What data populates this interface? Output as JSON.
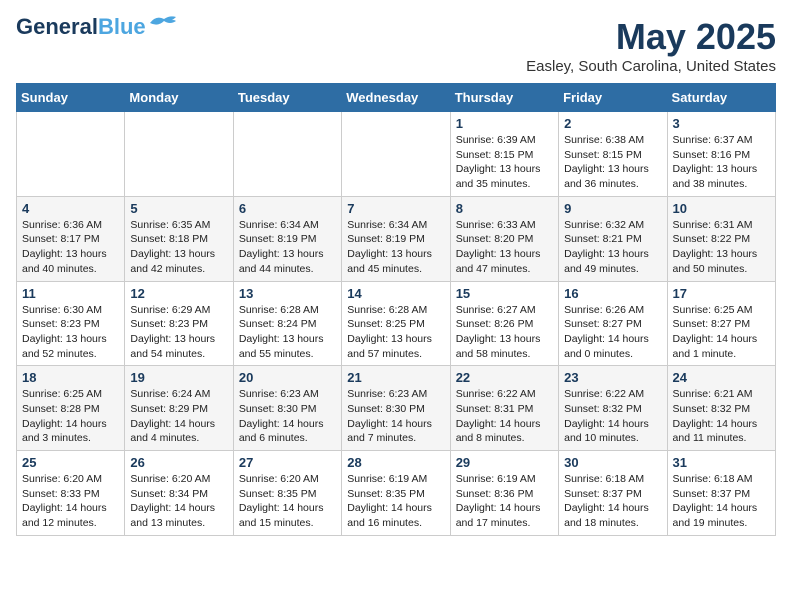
{
  "header": {
    "logo_general": "General",
    "logo_blue": "Blue",
    "month_title": "May 2025",
    "location": "Easley, South Carolina, United States"
  },
  "days_of_week": [
    "Sunday",
    "Monday",
    "Tuesday",
    "Wednesday",
    "Thursday",
    "Friday",
    "Saturday"
  ],
  "weeks": [
    [
      {
        "day": "",
        "info": ""
      },
      {
        "day": "",
        "info": ""
      },
      {
        "day": "",
        "info": ""
      },
      {
        "day": "",
        "info": ""
      },
      {
        "day": "1",
        "info": "Sunrise: 6:39 AM\nSunset: 8:15 PM\nDaylight: 13 hours\nand 35 minutes."
      },
      {
        "day": "2",
        "info": "Sunrise: 6:38 AM\nSunset: 8:15 PM\nDaylight: 13 hours\nand 36 minutes."
      },
      {
        "day": "3",
        "info": "Sunrise: 6:37 AM\nSunset: 8:16 PM\nDaylight: 13 hours\nand 38 minutes."
      }
    ],
    [
      {
        "day": "4",
        "info": "Sunrise: 6:36 AM\nSunset: 8:17 PM\nDaylight: 13 hours\nand 40 minutes."
      },
      {
        "day": "5",
        "info": "Sunrise: 6:35 AM\nSunset: 8:18 PM\nDaylight: 13 hours\nand 42 minutes."
      },
      {
        "day": "6",
        "info": "Sunrise: 6:34 AM\nSunset: 8:19 PM\nDaylight: 13 hours\nand 44 minutes."
      },
      {
        "day": "7",
        "info": "Sunrise: 6:34 AM\nSunset: 8:19 PM\nDaylight: 13 hours\nand 45 minutes."
      },
      {
        "day": "8",
        "info": "Sunrise: 6:33 AM\nSunset: 8:20 PM\nDaylight: 13 hours\nand 47 minutes."
      },
      {
        "day": "9",
        "info": "Sunrise: 6:32 AM\nSunset: 8:21 PM\nDaylight: 13 hours\nand 49 minutes."
      },
      {
        "day": "10",
        "info": "Sunrise: 6:31 AM\nSunset: 8:22 PM\nDaylight: 13 hours\nand 50 minutes."
      }
    ],
    [
      {
        "day": "11",
        "info": "Sunrise: 6:30 AM\nSunset: 8:23 PM\nDaylight: 13 hours\nand 52 minutes."
      },
      {
        "day": "12",
        "info": "Sunrise: 6:29 AM\nSunset: 8:23 PM\nDaylight: 13 hours\nand 54 minutes."
      },
      {
        "day": "13",
        "info": "Sunrise: 6:28 AM\nSunset: 8:24 PM\nDaylight: 13 hours\nand 55 minutes."
      },
      {
        "day": "14",
        "info": "Sunrise: 6:28 AM\nSunset: 8:25 PM\nDaylight: 13 hours\nand 57 minutes."
      },
      {
        "day": "15",
        "info": "Sunrise: 6:27 AM\nSunset: 8:26 PM\nDaylight: 13 hours\nand 58 minutes."
      },
      {
        "day": "16",
        "info": "Sunrise: 6:26 AM\nSunset: 8:27 PM\nDaylight: 14 hours\nand 0 minutes."
      },
      {
        "day": "17",
        "info": "Sunrise: 6:25 AM\nSunset: 8:27 PM\nDaylight: 14 hours\nand 1 minute."
      }
    ],
    [
      {
        "day": "18",
        "info": "Sunrise: 6:25 AM\nSunset: 8:28 PM\nDaylight: 14 hours\nand 3 minutes."
      },
      {
        "day": "19",
        "info": "Sunrise: 6:24 AM\nSunset: 8:29 PM\nDaylight: 14 hours\nand 4 minutes."
      },
      {
        "day": "20",
        "info": "Sunrise: 6:23 AM\nSunset: 8:30 PM\nDaylight: 14 hours\nand 6 minutes."
      },
      {
        "day": "21",
        "info": "Sunrise: 6:23 AM\nSunset: 8:30 PM\nDaylight: 14 hours\nand 7 minutes."
      },
      {
        "day": "22",
        "info": "Sunrise: 6:22 AM\nSunset: 8:31 PM\nDaylight: 14 hours\nand 8 minutes."
      },
      {
        "day": "23",
        "info": "Sunrise: 6:22 AM\nSunset: 8:32 PM\nDaylight: 14 hours\nand 10 minutes."
      },
      {
        "day": "24",
        "info": "Sunrise: 6:21 AM\nSunset: 8:32 PM\nDaylight: 14 hours\nand 11 minutes."
      }
    ],
    [
      {
        "day": "25",
        "info": "Sunrise: 6:20 AM\nSunset: 8:33 PM\nDaylight: 14 hours\nand 12 minutes."
      },
      {
        "day": "26",
        "info": "Sunrise: 6:20 AM\nSunset: 8:34 PM\nDaylight: 14 hours\nand 13 minutes."
      },
      {
        "day": "27",
        "info": "Sunrise: 6:20 AM\nSunset: 8:35 PM\nDaylight: 14 hours\nand 15 minutes."
      },
      {
        "day": "28",
        "info": "Sunrise: 6:19 AM\nSunset: 8:35 PM\nDaylight: 14 hours\nand 16 minutes."
      },
      {
        "day": "29",
        "info": "Sunrise: 6:19 AM\nSunset: 8:36 PM\nDaylight: 14 hours\nand 17 minutes."
      },
      {
        "day": "30",
        "info": "Sunrise: 6:18 AM\nSunset: 8:37 PM\nDaylight: 14 hours\nand 18 minutes."
      },
      {
        "day": "31",
        "info": "Sunrise: 6:18 AM\nSunset: 8:37 PM\nDaylight: 14 hours\nand 19 minutes."
      }
    ]
  ]
}
